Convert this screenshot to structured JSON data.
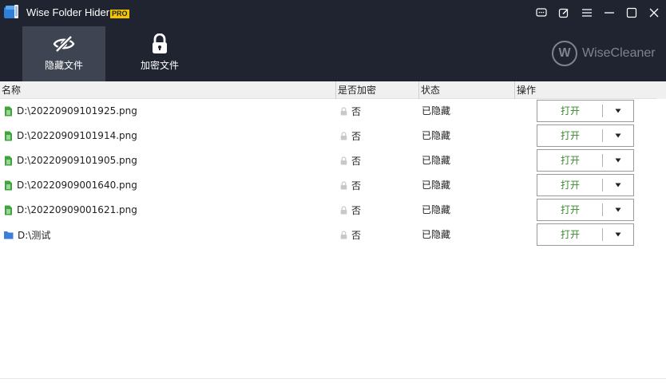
{
  "window": {
    "title": "Wise Folder Hider",
    "badge": "PRO"
  },
  "toolbar": {
    "hide_files": "隐藏文件",
    "encrypt_files": "加密文件",
    "brand": "WiseCleaner",
    "brand_logo_letter": "W"
  },
  "table": {
    "headers": {
      "name": "名称",
      "encrypted": "是否加密",
      "status": "状态",
      "action": "操作"
    },
    "rows": [
      {
        "icon": "file-icon",
        "name": "D:\\20220909101925.png",
        "encrypted": "否",
        "status": "已隐藏",
        "open": "打开"
      },
      {
        "icon": "file-icon",
        "name": "D:\\20220909101914.png",
        "encrypted": "否",
        "status": "已隐藏",
        "open": "打开"
      },
      {
        "icon": "file-icon",
        "name": "D:\\20220909101905.png",
        "encrypted": "否",
        "status": "已隐藏",
        "open": "打开"
      },
      {
        "icon": "file-icon",
        "name": "D:\\20220909001640.png",
        "encrypted": "否",
        "status": "已隐藏",
        "open": "打开"
      },
      {
        "icon": "file-icon",
        "name": "D:\\20220909001621.png",
        "encrypted": "否",
        "status": "已隐藏",
        "open": "打开"
      },
      {
        "icon": "folder-icon",
        "name": "D:\\测试",
        "encrypted": "否",
        "status": "已隐藏",
        "open": "打开"
      }
    ]
  },
  "colors": {
    "titlebar": "#1f2430",
    "active_tab": "#3e4451",
    "open_text": "#3a8a2c",
    "file_icon": "#3ea53a",
    "folder_icon": "#3b7fd9"
  }
}
